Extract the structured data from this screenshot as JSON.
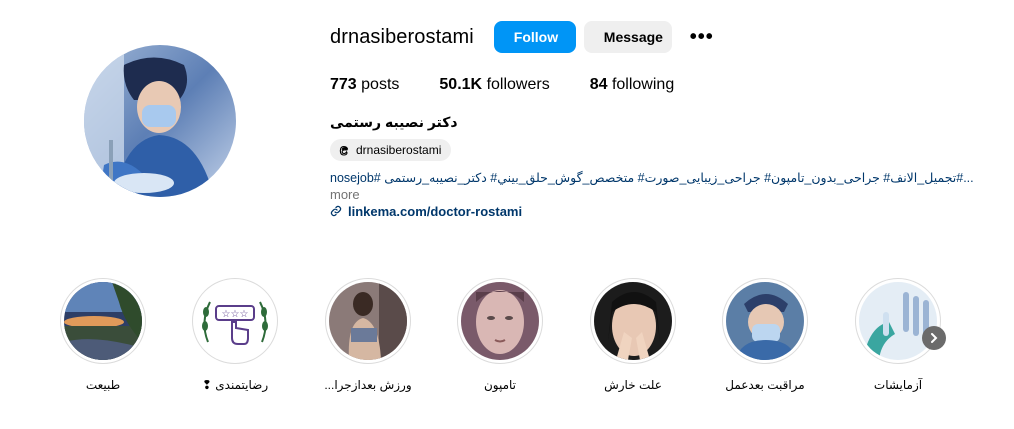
{
  "header": {
    "username": "drnasiberostami",
    "follow_label": "Follow",
    "message_label": "Message",
    "more_label": "•••"
  },
  "stats": {
    "posts_count": "773",
    "posts_label": "posts",
    "followers_count": "50.1K",
    "followers_label": "followers",
    "following_count": "84",
    "following_label": "following"
  },
  "bio": {
    "full_name": "دکتر نصیبه رستمی",
    "threads_handle": "drnasiberostami",
    "text": "nosejob# تجمیل_الانف# جراحی_بدون_تامپون# جراحی_زیبایی_صورت# متخصص_گوش_حلق_بيني# دكتر_نصيبه_رستمى#...",
    "more_label": "more",
    "link": "linkema.com/doctor-rostami"
  },
  "highlights": [
    {
      "label": "طبیعت",
      "icon": "nature-photo"
    },
    {
      "label": "رضایتمندی ❢",
      "icon": "rating-hand-icon"
    },
    {
      "label": "ورزش بعدازجرا...",
      "icon": "workout-photo"
    },
    {
      "label": "تامپون",
      "icon": "face-photo"
    },
    {
      "label": "علت خارش",
      "icon": "nose-itch-photo"
    },
    {
      "label": "مراقبت بعدعمل",
      "icon": "surgeon-photo"
    },
    {
      "label": "آزمایشات",
      "icon": "lab-photo"
    }
  ],
  "colors": {
    "follow_blue": "#0095f6",
    "link_blue": "#00376b",
    "muted": "#737373"
  }
}
